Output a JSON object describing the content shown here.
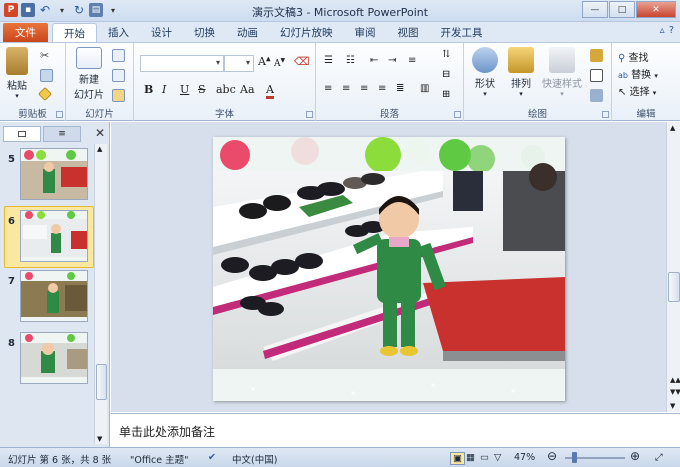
{
  "window": {
    "title": "演示文稿3 - Microsoft PowerPoint",
    "app_icon": "P"
  },
  "tabs": [
    {
      "label": "文件"
    },
    {
      "label": "开始"
    },
    {
      "label": "插入"
    },
    {
      "label": "设计"
    },
    {
      "label": "切换"
    },
    {
      "label": "动画"
    },
    {
      "label": "幻灯片放映"
    },
    {
      "label": "审阅"
    },
    {
      "label": "视图"
    },
    {
      "label": "开发工具"
    }
  ],
  "ribbon": {
    "clipboard": {
      "label": "剪贴板",
      "paste": "粘贴"
    },
    "slides": {
      "label": "幻灯片",
      "new_slide_line1": "新建",
      "new_slide_line2": "幻灯片"
    },
    "font": {
      "label": "字体"
    },
    "paragraph": {
      "label": "段落"
    },
    "drawing": {
      "label": "绘图",
      "shape": "形状",
      "arrange": "排列",
      "quick_styles": "快速样式"
    },
    "editing": {
      "label": "编辑",
      "find": "查找",
      "replace": "替换",
      "select": "选择"
    }
  },
  "slides_pane": {
    "items": [
      {
        "num": "5"
      },
      {
        "num": "6"
      },
      {
        "num": "7"
      },
      {
        "num": "8"
      }
    ]
  },
  "notes": {
    "placeholder": "单击此处添加备注"
  },
  "status": {
    "slide_info": "幻灯片 第 6 张，共 8 张",
    "theme": "\"Office 主题\"",
    "language": "中文(中国)",
    "zoom": "47%"
  },
  "colors": {
    "file_tab": "#d24726",
    "selected_slide": "#fbe8a0",
    "ribbon_border": "#9fb5d2"
  }
}
